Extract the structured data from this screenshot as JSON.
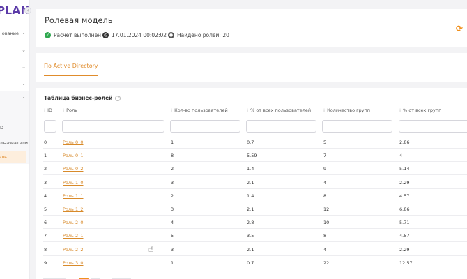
{
  "sidebar": {
    "logo": "PLAN",
    "collapse_glyph": "‹",
    "items": [
      {
        "label": "ование",
        "chevron": "⌄"
      },
      {
        "label": "",
        "chevron": "⌄"
      },
      {
        "label": "",
        "chevron": "⌄"
      },
      {
        "label": "",
        "chevron": "⌄"
      },
      {
        "label": "",
        "chevron": "⌃"
      },
      {
        "label": "D",
        "chevron": ""
      },
      {
        "label": "ользователи",
        "chevron": ""
      },
      {
        "label": "дель",
        "chevron": ""
      }
    ]
  },
  "header": {
    "title": "Ролевая модель",
    "status": "Расчет выполнен",
    "datetime": "17.01.2024 00:02:02",
    "roles_found": "Найдено ролей: 20"
  },
  "tabs": [
    {
      "label": "По Active Directory",
      "active": true
    }
  ],
  "table": {
    "title": "Таблица бизнес-ролей",
    "help_glyph": "?",
    "columns": [
      "ID",
      "Роль",
      "Кол-во пользователей",
      "% от всех пользователей",
      "Количество групп",
      "% от всех групп"
    ],
    "rows": [
      [
        "0",
        "Роль 0_0",
        "1",
        "0.7",
        "5",
        "2.86"
      ],
      [
        "1",
        "Роль 0_1",
        "8",
        "5.59",
        "7",
        "4"
      ],
      [
        "2",
        "Роль 0_2",
        "2",
        "1.4",
        "9",
        "5.14"
      ],
      [
        "3",
        "Роль 1_0",
        "3",
        "2.1",
        "4",
        "2.29"
      ],
      [
        "4",
        "Роль 1_1",
        "2",
        "1.4",
        "8",
        "4.57"
      ],
      [
        "5",
        "Роль 1_2",
        "3",
        "2.1",
        "12",
        "6.86"
      ],
      [
        "6",
        "Роль 2_0",
        "4",
        "2.8",
        "10",
        "5.71"
      ],
      [
        "7",
        "Роль 2_1",
        "5",
        "3.5",
        "8",
        "4.57"
      ],
      [
        "8",
        "Роль 2_2",
        "3",
        "2.1",
        "4",
        "2.29"
      ],
      [
        "9",
        "Роль 3_0",
        "1",
        "0.7",
        "22",
        "12.57"
      ]
    ]
  },
  "colors": {
    "accent": "#e08c2c",
    "brand": "#5b3aa8",
    "success": "#2fa84f"
  }
}
